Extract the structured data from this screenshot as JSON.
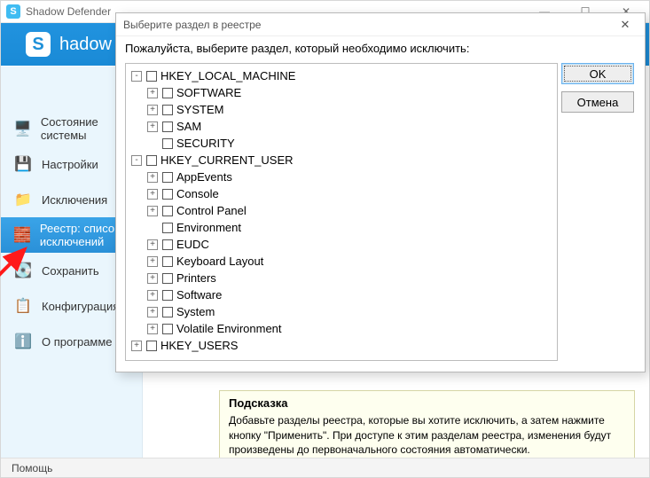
{
  "app": {
    "title": "Shadow Defender",
    "header_text": "hadow Defender"
  },
  "window_controls": {
    "min": "—",
    "max": "☐",
    "close": "✕"
  },
  "sidebar": {
    "items": [
      {
        "label": "Состояние системы",
        "icon": "🖥️"
      },
      {
        "label": "Настройки",
        "icon": "💾"
      },
      {
        "label": "Исключения",
        "icon": "📁"
      },
      {
        "label": "Реестр: список исключений",
        "icon": "🧱"
      },
      {
        "label": "Сохранить",
        "icon": "💽"
      },
      {
        "label": "Конфигурация",
        "icon": "📋"
      },
      {
        "label": "О программе",
        "icon": "ℹ️"
      }
    ],
    "active_index": 3
  },
  "hint": {
    "title": "Подсказка",
    "text": "Добавьте разделы реестра, которые вы хотите исключить, а затем нажмите кнопку \"Применить\". При доступе к этим разделам реестра, изменения будут произведены до первоначального состояния автоматически."
  },
  "statusbar": {
    "help": "Помощь"
  },
  "dialog": {
    "title": "Выберите раздел в реестре",
    "prompt": "Пожалуйста, выберите раздел, который необходимо исключить:",
    "buttons": {
      "ok": "OK",
      "cancel": "Отмена"
    },
    "tree": [
      {
        "level": 0,
        "expander": "-",
        "checkbox": true,
        "label": "HKEY_LOCAL_MACHINE"
      },
      {
        "level": 1,
        "expander": "+",
        "checkbox": true,
        "label": "SOFTWARE"
      },
      {
        "level": 1,
        "expander": "+",
        "checkbox": true,
        "label": "SYSTEM"
      },
      {
        "level": 1,
        "expander": "+",
        "checkbox": true,
        "label": "SAM"
      },
      {
        "level": 1,
        "expander": "",
        "checkbox": true,
        "label": "SECURITY"
      },
      {
        "level": 0,
        "expander": "-",
        "checkbox": true,
        "label": "HKEY_CURRENT_USER"
      },
      {
        "level": 1,
        "expander": "+",
        "checkbox": true,
        "label": "AppEvents"
      },
      {
        "level": 1,
        "expander": "+",
        "checkbox": true,
        "label": "Console"
      },
      {
        "level": 1,
        "expander": "+",
        "checkbox": true,
        "label": "Control Panel"
      },
      {
        "level": 1,
        "expander": "",
        "checkbox": true,
        "label": "Environment"
      },
      {
        "level": 1,
        "expander": "+",
        "checkbox": true,
        "label": "EUDC"
      },
      {
        "level": 1,
        "expander": "+",
        "checkbox": true,
        "label": "Keyboard Layout"
      },
      {
        "level": 1,
        "expander": "+",
        "checkbox": true,
        "label": "Printers"
      },
      {
        "level": 1,
        "expander": "+",
        "checkbox": true,
        "label": "Software"
      },
      {
        "level": 1,
        "expander": "+",
        "checkbox": true,
        "label": "System"
      },
      {
        "level": 1,
        "expander": "+",
        "checkbox": true,
        "label": "Volatile Environment"
      },
      {
        "level": 0,
        "expander": "+",
        "checkbox": true,
        "label": "HKEY_USERS"
      }
    ]
  }
}
